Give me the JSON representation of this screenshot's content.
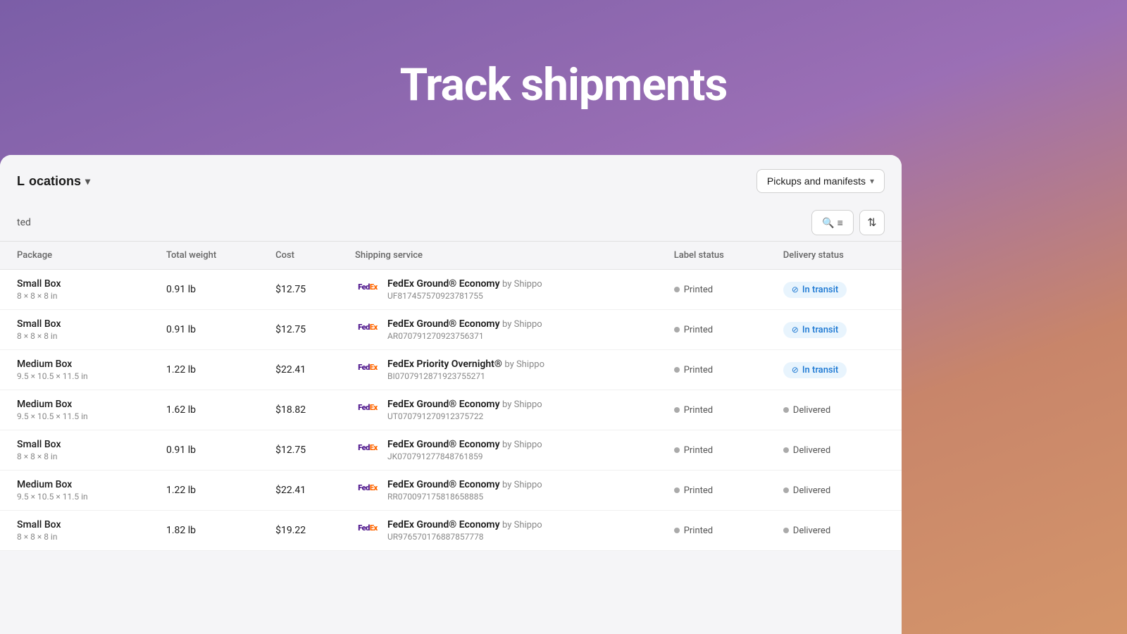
{
  "header": {
    "title": "Track shipments"
  },
  "topbar": {
    "locations_label": "ocations",
    "pickups_label": "Pickups and manifests"
  },
  "filterbar": {
    "filter_label": "ted"
  },
  "table": {
    "columns": [
      "Package",
      "Total weight",
      "Cost",
      "Shipping service",
      "Label status",
      "Delivery status"
    ],
    "rows": [
      {
        "package_name": "Small Box",
        "package_dims": "8 × 8 × 8 in",
        "weight": "0.91 lb",
        "cost": "$12.75",
        "service": "FedEx Ground® Economy",
        "by": "by Shippo",
        "tracking": "UF817457570923781755",
        "label_status": "Printed",
        "delivery_status": "In transit",
        "delivery_type": "transit"
      },
      {
        "package_name": "Small Box",
        "package_dims": "8 × 8 × 8 in",
        "weight": "0.91 lb",
        "cost": "$12.75",
        "service": "FedEx Ground® Economy",
        "by": "by Shippo",
        "tracking": "AR070791270923756371",
        "label_status": "Printed",
        "delivery_status": "In transit",
        "delivery_type": "transit"
      },
      {
        "package_name": "Medium Box",
        "package_dims": "9.5 × 10.5 × 11.5 in",
        "weight": "1.22 lb",
        "cost": "$22.41",
        "service": "FedEx Priority Overnight®",
        "by": "by Shippo",
        "tracking": "BI0707912871923755271",
        "label_status": "Printed",
        "delivery_status": "In transit",
        "delivery_type": "transit"
      },
      {
        "package_name": "Medium Box",
        "package_dims": "9.5 × 10.5 × 11.5 in",
        "weight": "1.62 lb",
        "cost": "$18.82",
        "service": "FedEx Ground® Economy",
        "by": "by Shippo",
        "tracking": "UT070791270912375722",
        "label_status": "Printed",
        "delivery_status": "Delivered",
        "delivery_type": "delivered"
      },
      {
        "package_name": "Small Box",
        "package_dims": "8 × 8 × 8 in",
        "weight": "0.91 lb",
        "cost": "$12.75",
        "service": "FedEx Ground® Economy",
        "by": "by Shippo",
        "tracking": "JK070791277848761859",
        "label_status": "Printed",
        "delivery_status": "Delivered",
        "delivery_type": "delivered"
      },
      {
        "package_name": "Medium Box",
        "package_dims": "9.5 × 10.5 × 11.5 in",
        "weight": "1.22 lb",
        "cost": "$22.41",
        "service": "FedEx Ground® Economy",
        "by": "by Shippo",
        "tracking": "RR070097175818658885",
        "label_status": "Printed",
        "delivery_status": "Delivered",
        "delivery_type": "delivered"
      },
      {
        "package_name": "Small Box",
        "package_dims": "8 × 8 × 8 in",
        "weight": "1.82 lb",
        "cost": "$19.22",
        "service": "FedEx Ground® Economy",
        "by": "by Shippo",
        "tracking": "UR976570176887857778",
        "label_status": "Printed",
        "delivery_status": "Delivered",
        "delivery_type": "delivered"
      }
    ]
  }
}
